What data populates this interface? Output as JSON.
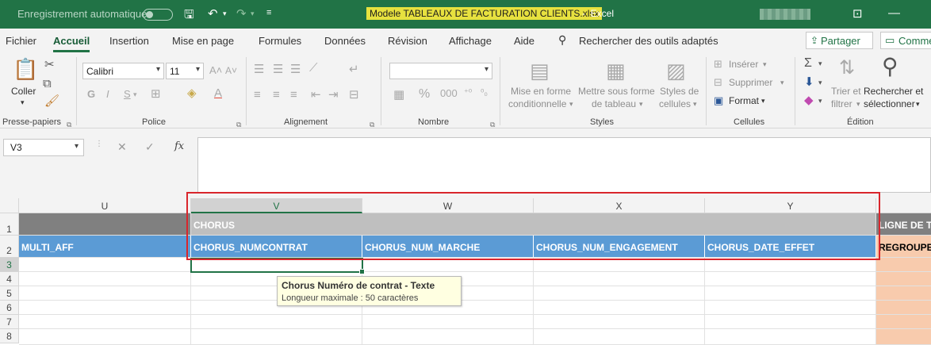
{
  "titlebar": {
    "autosave_label": "Enregistrement automatique",
    "filename": "Modele TABLEAUX DE FACTURATION CLIENTS.xlsx",
    "separator": "-",
    "app_name": "Excel"
  },
  "menu": {
    "items": [
      "Fichier",
      "Accueil",
      "Insertion",
      "Mise en page",
      "Formules",
      "Données",
      "Révision",
      "Affichage",
      "Aide"
    ],
    "search_label": "Rechercher des outils adaptés",
    "share_label": "Partager",
    "comments_label": "Comme"
  },
  "ribbon": {
    "clipboard": {
      "paste_label": "Coller",
      "group_label": "Presse-papiers"
    },
    "font": {
      "font_name": "Calibri",
      "font_size": "11",
      "bold": "G",
      "italic": "I",
      "underline": "S",
      "group_label": "Police"
    },
    "alignment": {
      "group_label": "Alignement"
    },
    "number": {
      "percent": "%",
      "group_label": "Nombre"
    },
    "styles": {
      "conditional_line1": "Mise en forme",
      "conditional_line2": "conditionnelle",
      "table_line1": "Mettre sous forme",
      "table_line2": "de tableau",
      "cell_styles_line1": "Styles de",
      "cell_styles_line2": "cellules",
      "group_label": "Styles"
    },
    "cells": {
      "insert": "Insérer",
      "delete": "Supprimer",
      "format": "Format",
      "group_label": "Cellules"
    },
    "editing": {
      "sort_line1": "Trier et",
      "sort_line2": "filtrer",
      "find_line1": "Rechercher et",
      "find_line2": "sélectionner",
      "group_label": "Édition"
    }
  },
  "formula_bar": {
    "name_box": "V3",
    "fx": "fx",
    "value": ""
  },
  "sheet": {
    "columns": [
      "U",
      "V",
      "W",
      "X",
      "Y"
    ],
    "rows": [
      "1",
      "2",
      "3",
      "4",
      "5",
      "6",
      "7",
      "8"
    ],
    "row1": {
      "V": "CHORUS",
      "Z": "LIGNE DE TA"
    },
    "row2": {
      "U": "MULTI_AFF",
      "V": "CHORUS_NUMCONTRAT",
      "W": "CHORUS_NUM_MARCHE",
      "X": "CHORUS_NUM_ENGAGEMENT",
      "Y": "CHORUS_DATE_EFFET",
      "Z": "REGROUPE"
    }
  },
  "tooltip": {
    "title": "Chorus Numéro de contrat - Texte",
    "body": "Longueur maximale : 50 caractères"
  },
  "colors": {
    "excel_green": "#217346",
    "header_blue": "#5b9bd5",
    "header_gray": "#bfbfbf",
    "salmon": "#f8cbad",
    "highlight_red": "#d9262c"
  }
}
